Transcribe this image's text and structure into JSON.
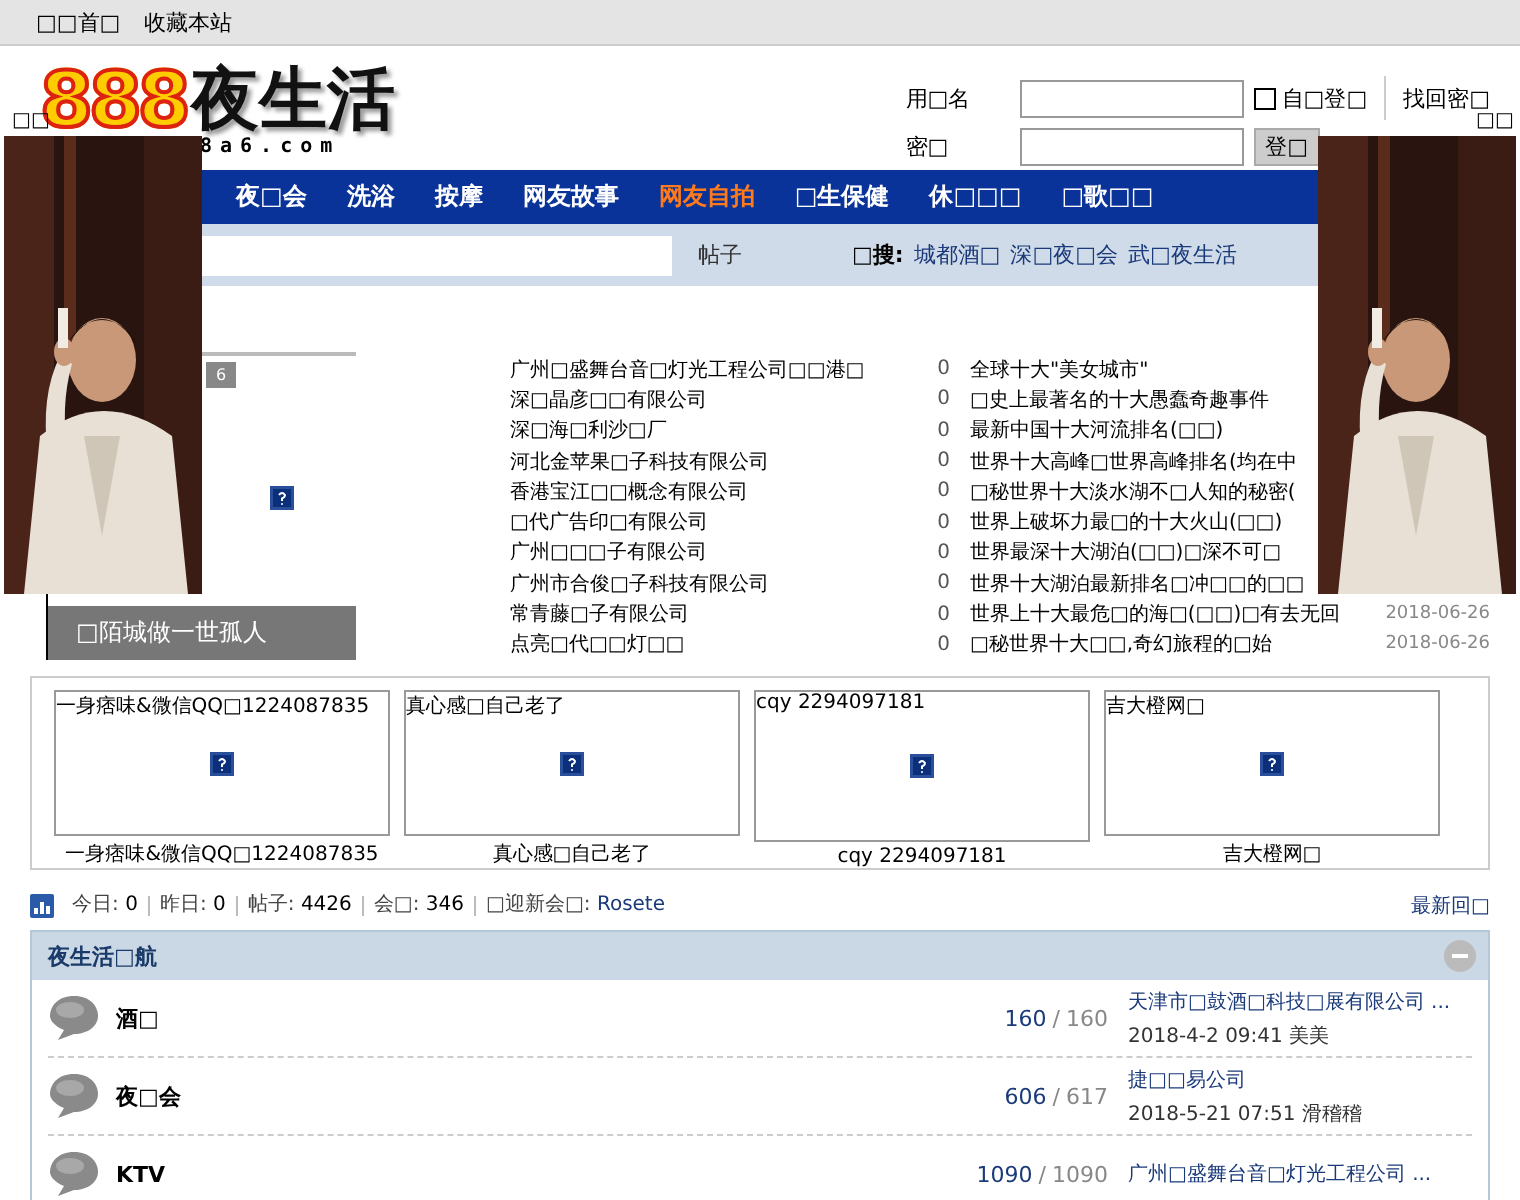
{
  "topbar": {
    "links": [
      "□□首□",
      "收藏本站"
    ]
  },
  "logo": {
    "digits": "888",
    "name": "夜生活",
    "domain": "8a6.com"
  },
  "login": {
    "username_label": "用□名",
    "password_label": "密□",
    "remember": {
      "label": "自□登□",
      "checked": false
    },
    "forgot": "找回密□",
    "submit": "登□"
  },
  "ads": [
    {
      "close": "□□",
      "kind": "picture"
    },
    {
      "close": "□□",
      "kind": "picture"
    }
  ],
  "nav": [
    {
      "label": "夜□会",
      "selected": false
    },
    {
      "label": "洗浴",
      "selected": false
    },
    {
      "label": "按摩",
      "selected": false
    },
    {
      "label": "网友故事",
      "selected": false
    },
    {
      "label": "网友自拍",
      "selected": true
    },
    {
      "label": "□生保健",
      "selected": false
    },
    {
      "label": "休□□□",
      "selected": false
    },
    {
      "label": "□歌□□",
      "selected": false
    }
  ],
  "search": {
    "scope": "帖子",
    "hot_label": "□搜:",
    "hot_links": [
      "城都酒□",
      "深□夜□会",
      "武□夜生活"
    ]
  },
  "slideshow": {
    "page": "6",
    "caption": "□陌城做一世孤人"
  },
  "companies": [
    {
      "name": "广州□盛舞台音□灯光工程公司□□港□",
      "count": "0"
    },
    {
      "name": "深□晶彦□□有限公司",
      "count": "0"
    },
    {
      "name": "深□海□利沙□厂",
      "count": "0"
    },
    {
      "name": "河北金苹果□子科技有限公司",
      "count": "0"
    },
    {
      "name": "香港宝江□□概念有限公司",
      "count": "0"
    },
    {
      "name": "□代广告印□有限公司",
      "count": "0"
    },
    {
      "name": "广州□□□子有限公司",
      "count": "0"
    },
    {
      "name": "广州市合俊□子科技有限公司",
      "count": "0"
    },
    {
      "name": "常青藤□子有限公司",
      "count": "0"
    },
    {
      "name": "点亮□代□□灯□□",
      "count": "0"
    }
  ],
  "articles": [
    {
      "title": "全球十大\"美女城市\""
    },
    {
      "title": "□史上最著名的十大愚蠢奇趣事件"
    },
    {
      "title": "最新中国十大河流排名(□□)"
    },
    {
      "title": "世界十大高峰□世界高峰排名(均在中"
    },
    {
      "title": "□秘世界十大淡水湖不□人知的秘密("
    },
    {
      "title": "世界上破坏力最□的十大火山(□□)"
    },
    {
      "title": "世界最深十大湖泊(□□)□深不可□"
    },
    {
      "title": "世界十大湖泊最新排名□冲□□的□□"
    },
    {
      "title": "世界上十大最危□的海□(□□)□有去无回",
      "date": "2018-06-26"
    },
    {
      "title": "□秘世界十大□□,奇幻旅程的□始",
      "date": "2018-06-26"
    }
  ],
  "gallery": [
    {
      "title": "一身痞味&微信QQ□1224087835",
      "caption": "一身痞味&微信QQ□1224087835"
    },
    {
      "title": "真心感□自己老了",
      "caption": "真心感□自己老了"
    },
    {
      "title": "cqy 2294097181",
      "caption": "cqy 2294097181"
    },
    {
      "title": "吉大橙网□",
      "caption": "吉大橙网□"
    }
  ],
  "stats": [
    {
      "label": "今日:",
      "value": "0"
    },
    {
      "label": "昨日:",
      "value": "0"
    },
    {
      "label": "帖子:",
      "value": "4426"
    },
    {
      "label": "会□:",
      "value": "346"
    },
    {
      "label": "□迎新会□:",
      "value": "Rosete",
      "link": true
    }
  ],
  "latest_link": "最新回□",
  "forum": {
    "title": "夜生活□航",
    "expanded": true,
    "boards": [
      {
        "name": "酒□",
        "threads": "160",
        "separator": "/",
        "posts": "160",
        "last_title": "天津市□鼓酒□科技□展有限公司 ...",
        "last_time": "2018-4-2 09:41",
        "last_user": "美美"
      },
      {
        "name": "夜□会",
        "threads": "606",
        "separator": "/",
        "posts": "617",
        "last_title": "捷□□易公司",
        "last_time": "2018-5-21 07:51",
        "last_user": "滑稽稽"
      },
      {
        "name": "KTV",
        "threads": "1090",
        "separator": "/",
        "posts": "1090",
        "last_title": "广州□盛舞台音□灯光工程公司 ..."
      }
    ]
  }
}
